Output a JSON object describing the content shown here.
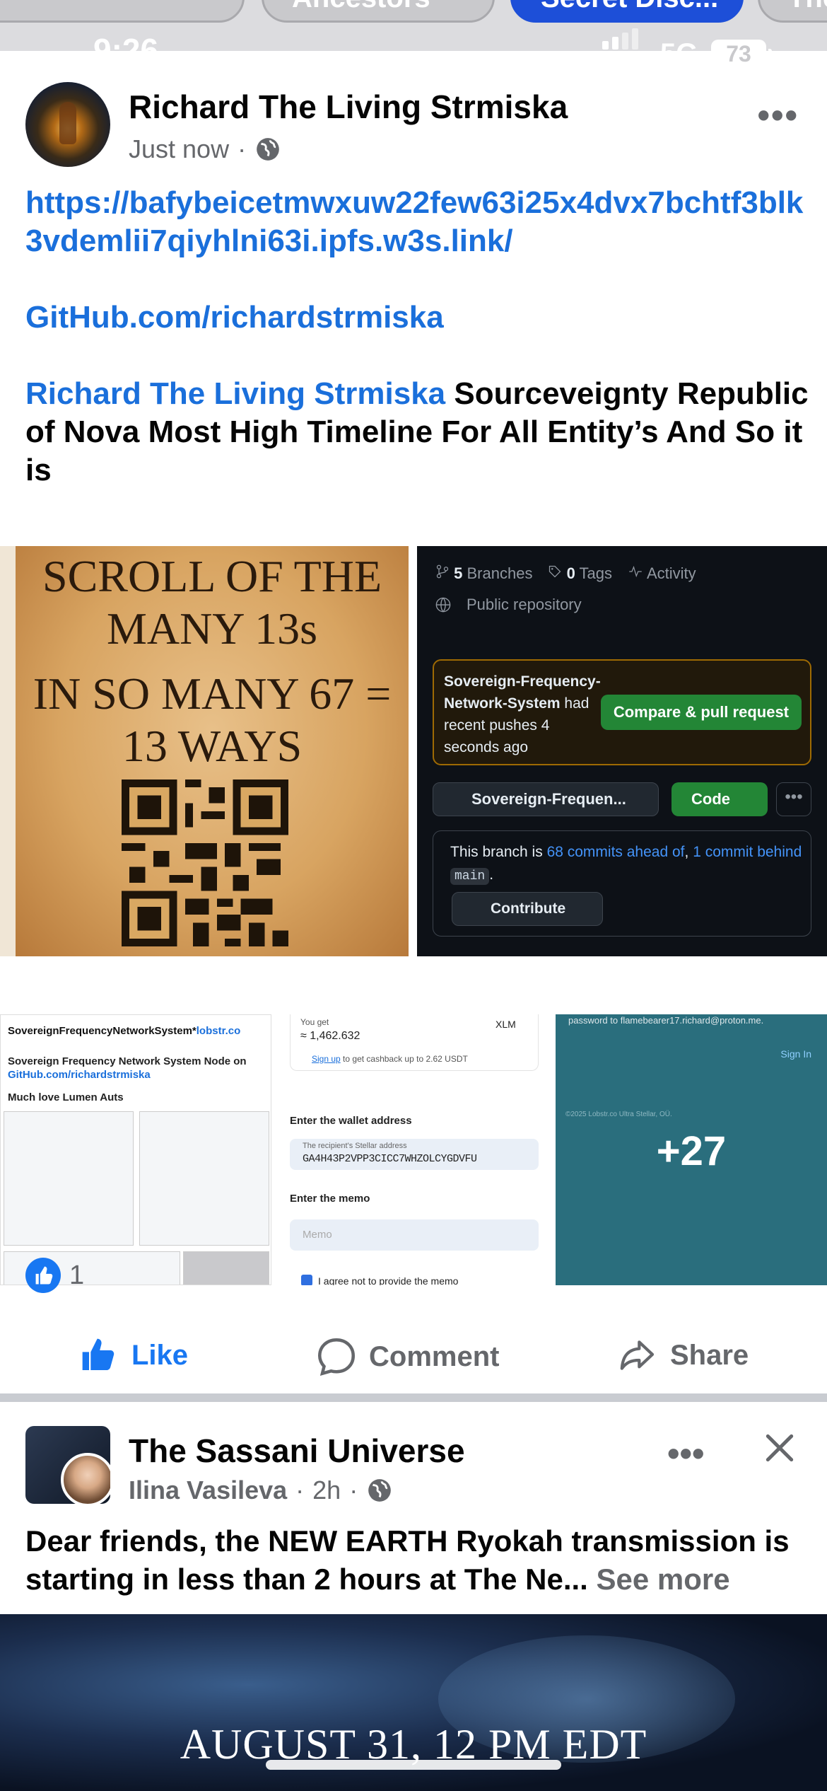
{
  "chips": [
    "Ancestors",
    "Secret Disc...",
    "The"
  ],
  "status": {
    "time": "9:26",
    "network": "5G",
    "battery": "73"
  },
  "post": {
    "author": "Richard The Living Strmiska",
    "timestamp": "Just now",
    "separator": "·",
    "link": "https://bafybeicetmwxuw22few63i25x4dvx7bchtf3blk3vdemlii7qiyhlni63i.ipfs.w3s.link/",
    "github": "GitHub.com/richardstrmiska",
    "mention": "Richard The Living Strmiska",
    "text": "Sourceveignty Republic of Nova Most High Timeline For All Entity’s And So it is",
    "media": {
      "scroll_title": "SCROLL OF THE MANY 13s",
      "scroll_sub": "IN SO MANY 67 = 13 WAYS",
      "gh_branches": "5",
      "gh_branches_label": "Branches",
      "gh_tags": "0",
      "gh_tags_label": "Tags",
      "gh_activity": "Activity",
      "gh_public": "Public repository",
      "gh_push_branch": "Sovereign-Frequency-Network-System",
      "gh_push_rest": "had recent pushes 4 seconds ago",
      "gh_compare": "Compare & pull request",
      "gh_branch_select": "Sovereign-Frequen...",
      "gh_code": "Code",
      "gh_info_1": "This branch is",
      "gh_info_ahead": "68 commits ahead of",
      "gh_info_sep": ",",
      "gh_info_behind": "1 commit behind",
      "gh_info_main": "main",
      "gh_info_end": ".",
      "gh_contribute": "Contribute",
      "lob_title": "SovereignFrequencyNetworkSystem*",
      "lob_domain": "lobstr.co",
      "lob_line1": "Sovereign Frequency Network System Node on",
      "lob_line2": "GitHub.com/richardstrmiska",
      "lob_line3": "Much love Lumen Auts",
      "wal_you_get": "You get",
      "wal_amount": "≈ 1,462.632",
      "wal_asset": "XLM",
      "wal_signup": "Sign up",
      "wal_signup_rest": "to get cashback up to 2.62 USDT",
      "wal_addr_label": "Enter the wallet address",
      "wal_addr_sub": "The recipient's Stellar address",
      "wal_addr_value": "GA4H43P2VPP3CICC7WHZOLCYGDVFU",
      "wal_memo_label": "Enter the memo",
      "wal_memo_placeholder": "Memo",
      "wal_agree": "I agree not to provide the memo",
      "more_top": "password to flamebearer17.richard@proton.me.",
      "more_signin": "Sign In",
      "more_copy": "©2025 Lobstr.co Ultra Stellar, OÜ.",
      "more_count": "+27"
    },
    "reactions": {
      "count": "1"
    },
    "actions": {
      "like": "Like",
      "comment": "Comment",
      "share": "Share"
    }
  },
  "post2": {
    "page": "The Sassani Universe",
    "author": "Ilina Vasileva",
    "timestamp": "2h",
    "separator": "·",
    "text": "Dear friends, the NEW EARTH Ryokah transmission is starting in less than 2 hours at The Ne...",
    "see_more": "See more",
    "banner_text": "AUGUST 31, 12 PM EDT"
  },
  "colors": {
    "link": "#1a6fdb",
    "like": "#1877f2",
    "github_green": "#238636"
  },
  "icons": [
    "globe-icon",
    "more-icon",
    "like-icon",
    "comment-icon",
    "share-icon",
    "close-icon",
    "branch-icon",
    "tag-icon",
    "activity-icon"
  ]
}
